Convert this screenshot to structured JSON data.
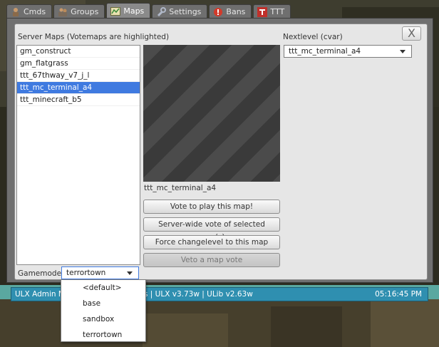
{
  "tabs": [
    {
      "label": "Cmds",
      "icon": "person-icon"
    },
    {
      "label": "Groups",
      "icon": "people-icon"
    },
    {
      "label": "Maps",
      "icon": "map-icon"
    },
    {
      "label": "Settings",
      "icon": "wrench-icon"
    },
    {
      "label": "Bans",
      "icon": "ban-icon"
    },
    {
      "label": "TTT",
      "icon": "ttt-logo-icon"
    }
  ],
  "active_tab": "Maps",
  "maps_panel": {
    "close_label": "X",
    "list_title": "Server Maps (Votemaps are highlighted)",
    "maps": [
      "gm_construct",
      "gm_flatgrass",
      "ttt_67thway_v7_j_l",
      "ttt_mc_terminal_a4",
      "ttt_minecraft_b5"
    ],
    "selected_map": "ttt_mc_terminal_a4",
    "preview_caption": "ttt_mc_terminal_a4",
    "buttons": {
      "vote": "Vote to play this map!",
      "server_vote": "Server-wide vote of selected map(s)",
      "force_change": "Force changelevel to this map",
      "veto": "Veto a map vote"
    },
    "nextlevel_label": "Nextlevel (cvar)",
    "nextlevel_value": "ttt_mc_terminal_a4",
    "gamemode_label": "Gamemode:",
    "gamemode_value": "terrortown",
    "gamemode_options": [
      "<default>",
      "base",
      "sandbox",
      "terrortown"
    ]
  },
  "statusbar": {
    "left_text": "ULX Admin Mo",
    "middle_text": "s  |  ULX v3.73w  |  ULib v2.63w",
    "time": "05:16:45 PM",
    "color": "#2f8fb0"
  },
  "colors": {
    "selection": "#3f7ae0"
  }
}
